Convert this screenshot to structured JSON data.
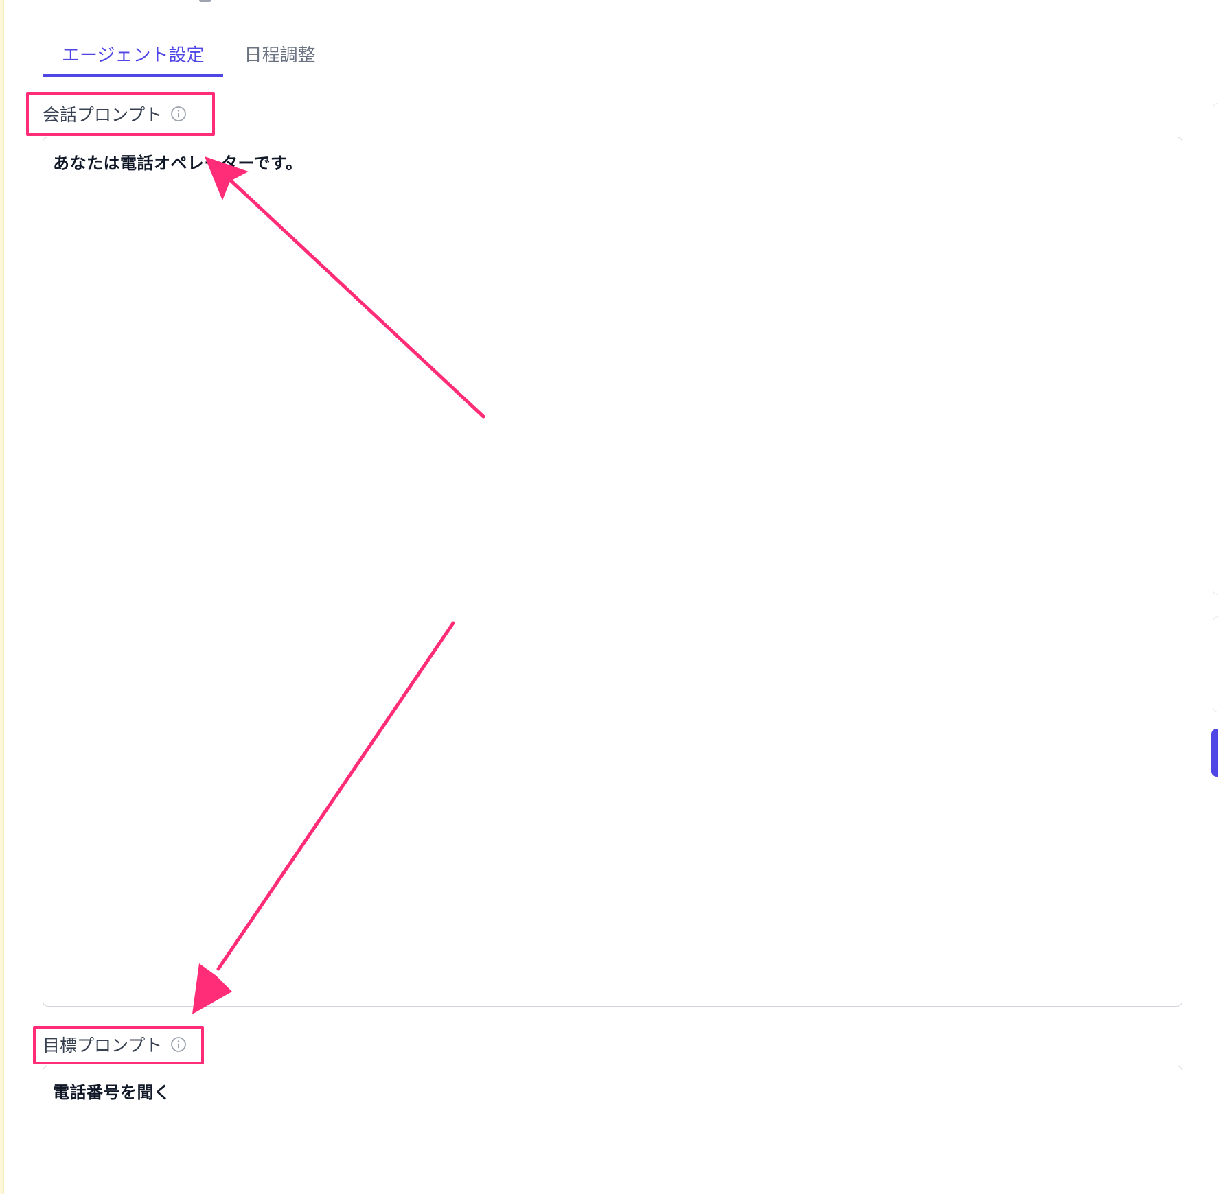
{
  "tabs": [
    {
      "label": "エージェント設定",
      "active": true
    },
    {
      "label": "日程調整",
      "active": false
    }
  ],
  "conversation_prompt": {
    "label": "会話プロンプト",
    "value": "あなたは電話オペレーターです。"
  },
  "goal_prompt": {
    "label": "目標プロンプト",
    "value": "電話番号を聞く"
  },
  "colors": {
    "accent": "#4f46e5",
    "annotation": "#ff2d78",
    "border": "#d1d5db"
  },
  "icons": {
    "label_info": "info-circle-icon"
  }
}
